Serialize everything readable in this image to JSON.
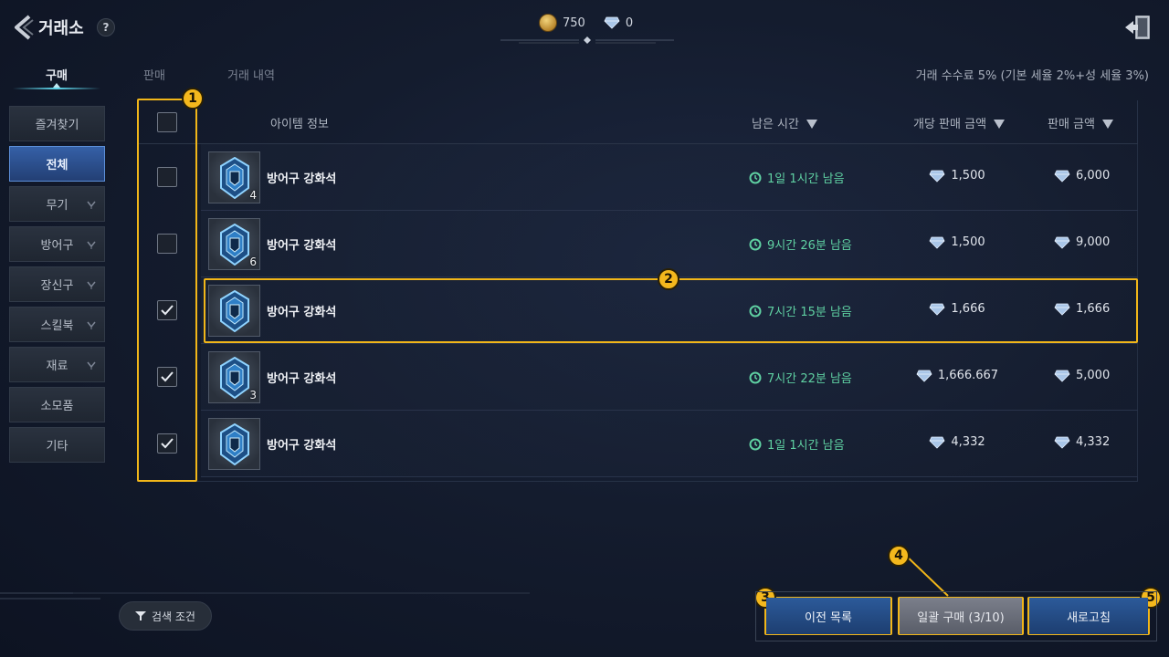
{
  "header": {
    "title": "거래소",
    "help_label": "?",
    "gold": "750",
    "diamonds": "0"
  },
  "tabs": [
    "구매",
    "판매",
    "거래 내역"
  ],
  "fee_text": "거래 수수료 5% (기본 세율 2%+성 세율 3%)",
  "categories": [
    "즐겨찾기",
    "전체",
    "무기",
    "방어구",
    "장신구",
    "스킬북",
    "재료",
    "소모품",
    "기타"
  ],
  "table": {
    "columns": [
      "아이템 정보",
      "남은 시간",
      "개당 판매 금액",
      "판매 금액"
    ],
    "rows": [
      {
        "name": "방어구 강화석",
        "qty": "4",
        "time": "1일 1시간 남음",
        "unit_price": "1,500",
        "total": "6,000",
        "checked": false
      },
      {
        "name": "방어구 강화석",
        "qty": "6",
        "time": "9시간 26분 남음",
        "unit_price": "1,500",
        "total": "9,000",
        "checked": false
      },
      {
        "name": "방어구 강화석",
        "qty": "",
        "time": "7시간 15분 남음",
        "unit_price": "1,666",
        "total": "1,666",
        "checked": true
      },
      {
        "name": "방어구 강화석",
        "qty": "3",
        "time": "7시간 22분 남음",
        "unit_price": "1,666.667",
        "total": "5,000",
        "checked": true
      },
      {
        "name": "방어구 강화석",
        "qty": "",
        "time": "1일 1시간 남음",
        "unit_price": "4,332",
        "total": "4,332",
        "checked": true
      }
    ]
  },
  "annotations": [
    "1",
    "2",
    "3",
    "4",
    "5"
  ],
  "footer": {
    "filter_label": "검색 조건",
    "prev_list": "이전 목록",
    "bulk_buy": "일괄 구매 (3/10)",
    "refresh": "새로고침"
  },
  "colors": {
    "highlight": "#f1b619",
    "timer_green": "#5fd0a2",
    "active_tab_blue": "#3560a7"
  }
}
